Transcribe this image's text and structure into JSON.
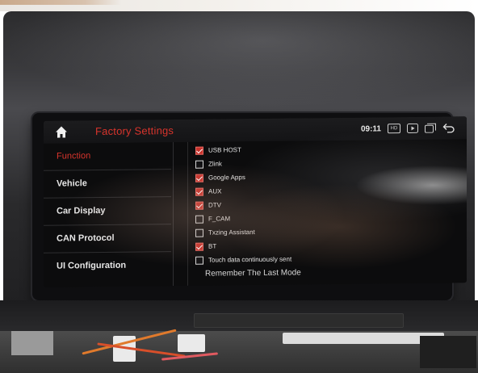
{
  "header": {
    "title": "Factory Settings",
    "time": "09:11",
    "hd_badge": "HD"
  },
  "sidebar": {
    "items": [
      {
        "label": "Function",
        "active": true
      },
      {
        "label": "Vehicle",
        "active": false
      },
      {
        "label": "Car Display",
        "active": false
      },
      {
        "label": "CAN Protocol",
        "active": false
      },
      {
        "label": "UI Configuration",
        "active": false
      }
    ]
  },
  "options": {
    "items": [
      {
        "label": "USB HOST",
        "checked": true
      },
      {
        "label": "Zlink",
        "checked": false
      },
      {
        "label": "Google Apps",
        "checked": true
      },
      {
        "label": "AUX",
        "checked": true
      },
      {
        "label": "DTV",
        "checked": true
      },
      {
        "label": "F_CAM",
        "checked": false
      },
      {
        "label": "Txzing Assistant",
        "checked": false
      },
      {
        "label": "BT",
        "checked": true
      },
      {
        "label": "Touch data continuously sent",
        "checked": false
      }
    ],
    "partial_label": "Remember The Last Mode"
  },
  "colors": {
    "accent": "#d8342c",
    "checkbox_checked": "#c8322c",
    "screen_bg": "#0c0c0d",
    "text": "#e4e4e4"
  },
  "icons": {
    "home": "home-icon",
    "hd": "hd-icon",
    "media": "media-icon",
    "window": "window-icon",
    "back": "back-arrow-icon"
  }
}
